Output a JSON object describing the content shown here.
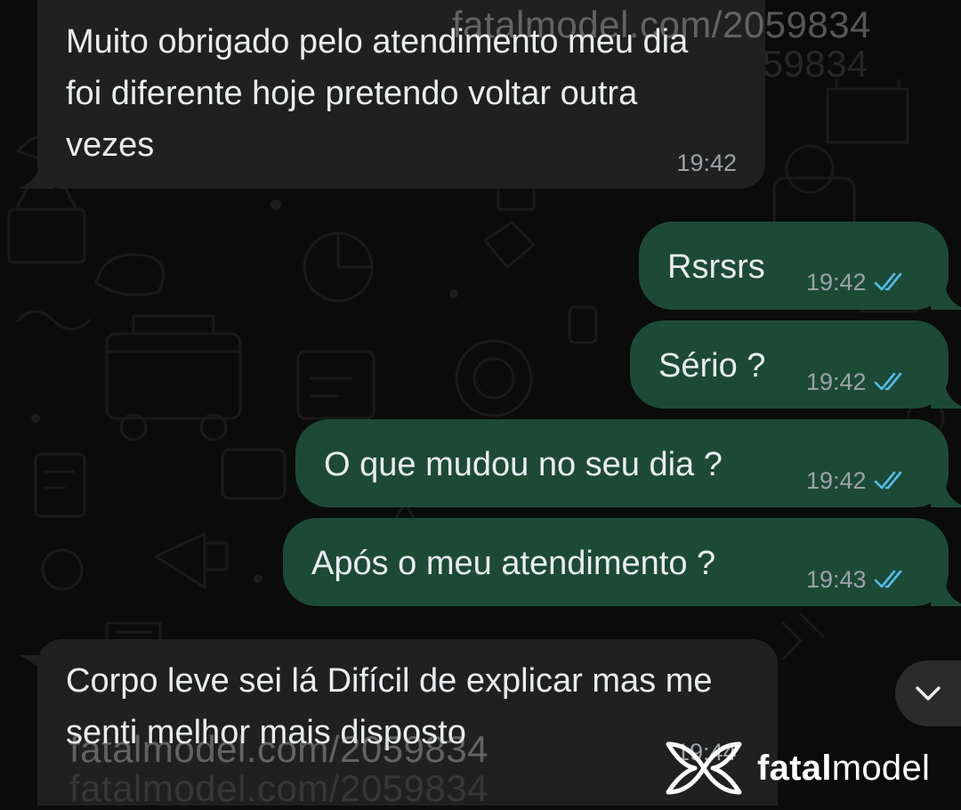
{
  "colors": {
    "background": "#0b0b0b",
    "incoming_bubble": "#202020",
    "outgoing_bubble": "#1d4a37",
    "text": "#e9edef",
    "timestamp": "#9ba3a7",
    "read_ticks": "#53bdeb"
  },
  "watermark": {
    "text": "fatalmodel.com/2059834"
  },
  "messages": [
    {
      "direction": "incoming",
      "text": "Muito obrigado pelo atendimento meu dia foi diferente hoje pretendo voltar outra vezes",
      "time": "19:42"
    },
    {
      "direction": "outgoing",
      "text": "Rsrsrs",
      "time": "19:42",
      "status": "read"
    },
    {
      "direction": "outgoing",
      "text": "Sério ?",
      "time": "19:42",
      "status": "read"
    },
    {
      "direction": "outgoing",
      "text": "O que mudou no seu dia ?",
      "time": "19:42",
      "status": "read"
    },
    {
      "direction": "outgoing",
      "text": "Após o meu atendimento ?",
      "time": "19:43",
      "status": "read"
    },
    {
      "direction": "incoming",
      "text": "Corpo leve sei lá Difícil de explicar mas me senti melhor mais disposto",
      "time": "19:44"
    }
  ],
  "scroll_button": {
    "icon": "chevron-down-icon"
  },
  "brand": {
    "logo_icon": "fatalmodel-logo-icon",
    "name_bold": "fatal",
    "name_regular": "model"
  }
}
